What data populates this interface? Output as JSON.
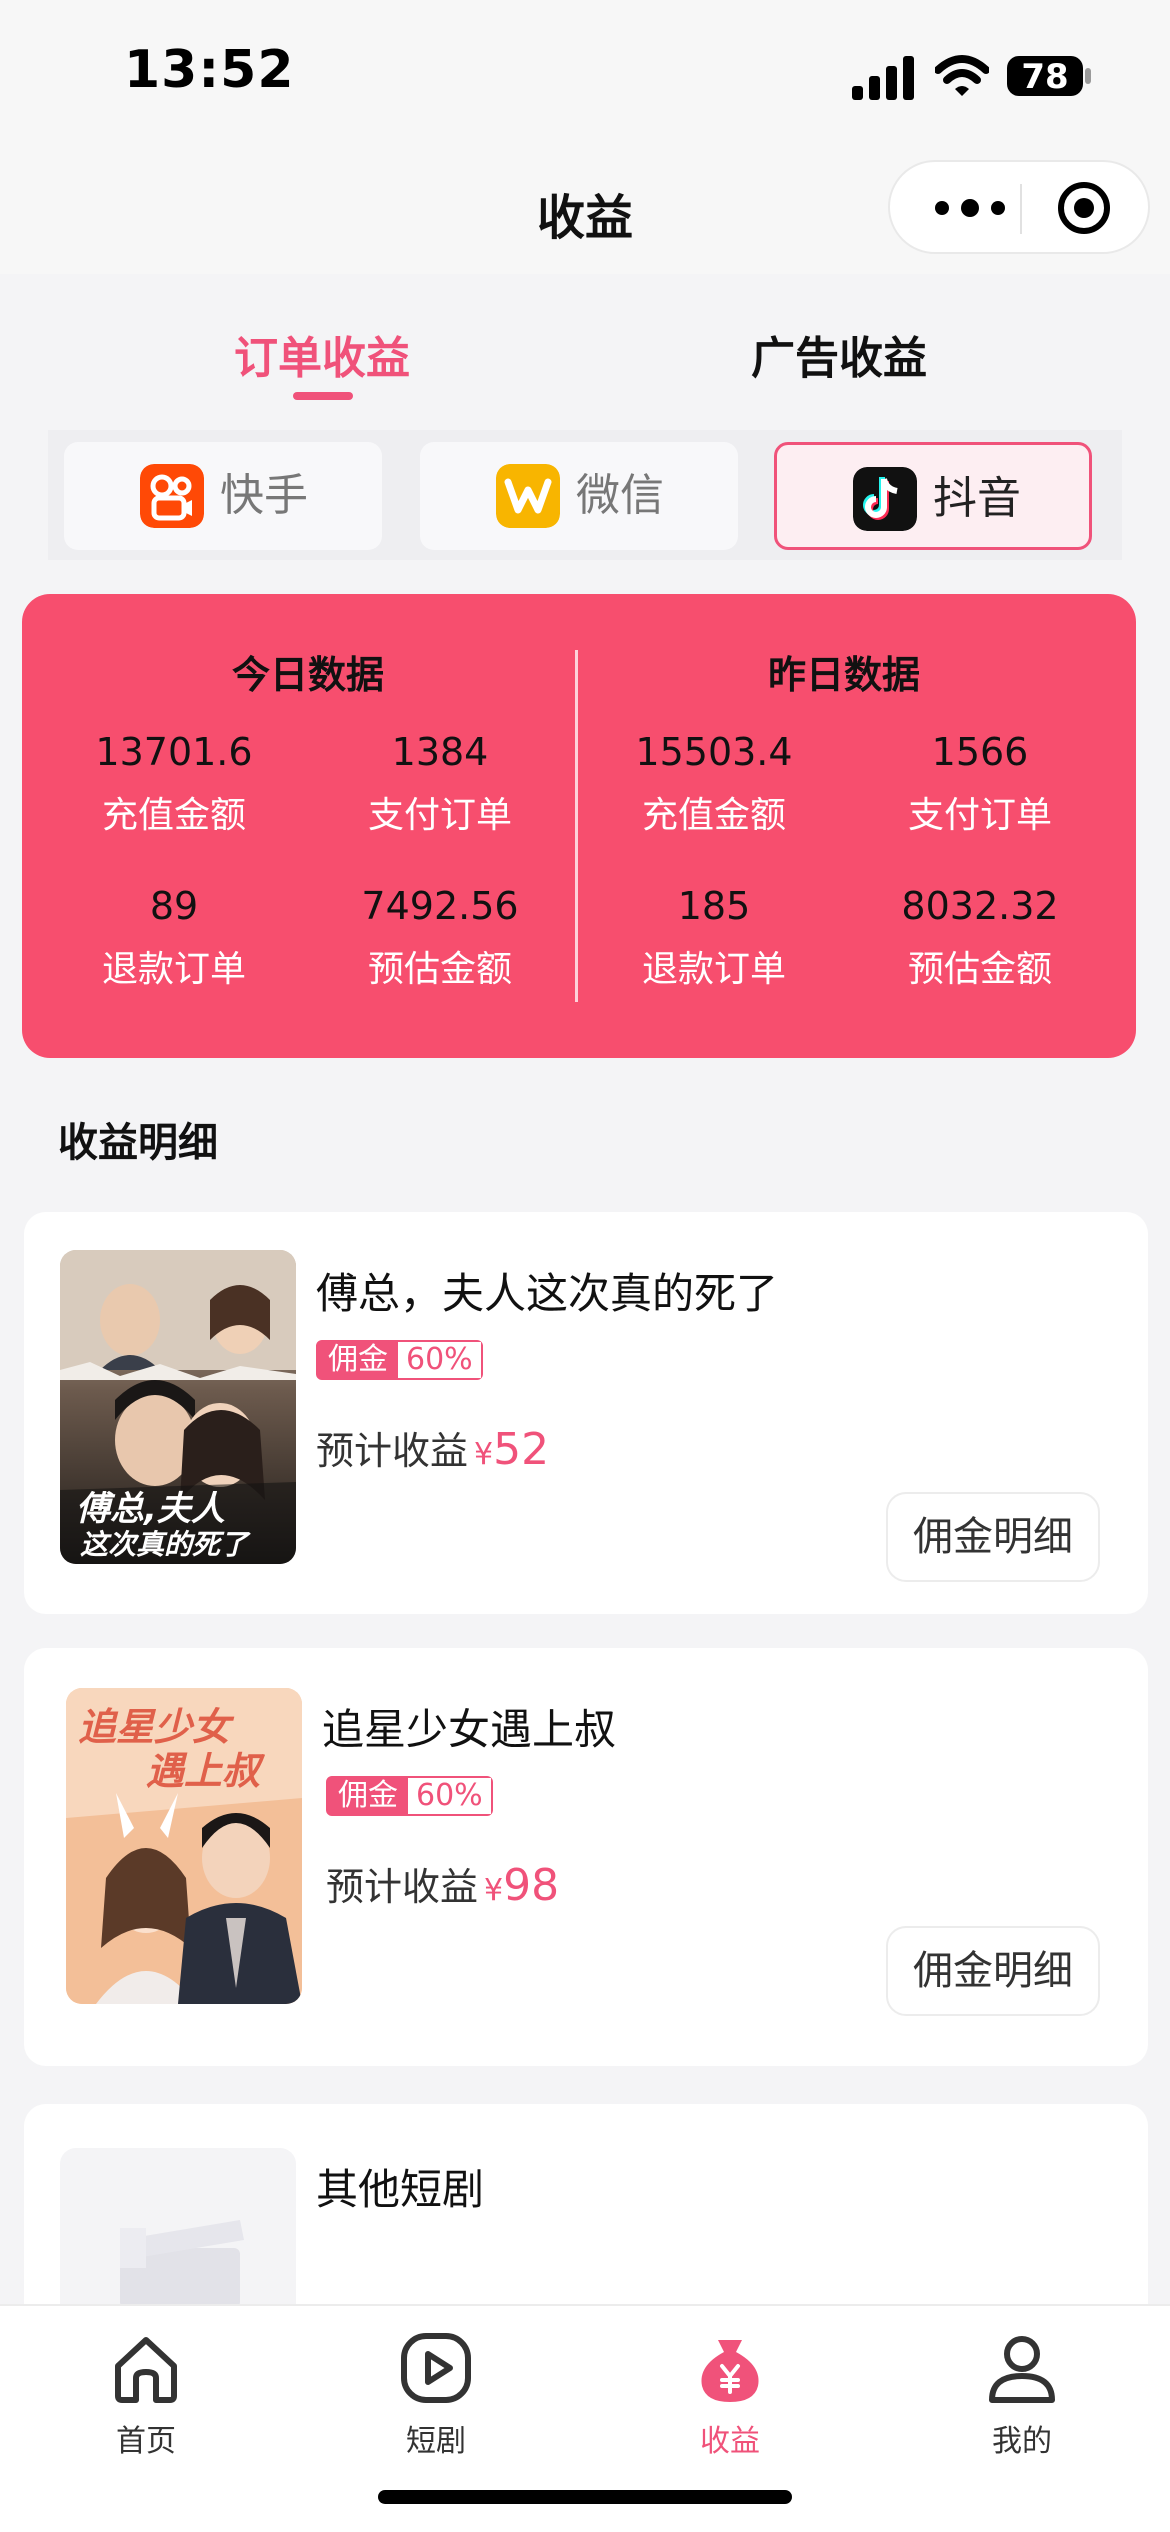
{
  "status_bar": {
    "time": "13:52",
    "battery": "78"
  },
  "nav": {
    "title": "收益"
  },
  "main_tabs": [
    {
      "label": "订单收益",
      "active": true
    },
    {
      "label": "广告收益",
      "active": false
    }
  ],
  "platforms": [
    {
      "label": "快手",
      "icon": "kuaishou-icon",
      "color": "#ff4906",
      "active": false
    },
    {
      "label": "微信",
      "icon": "wechat-icon",
      "color": "#f8b500",
      "active": false
    },
    {
      "label": "抖音",
      "icon": "douyin-icon",
      "color": "#111111",
      "active": true
    }
  ],
  "stats": {
    "today": {
      "title": "今日数据",
      "items": [
        {
          "value": "13701.6",
          "label": "充值金额"
        },
        {
          "value": "1384",
          "label": "支付订单"
        },
        {
          "value": "89",
          "label": "退款订单"
        },
        {
          "value": "7492.56",
          "label": "预估金额"
        }
      ]
    },
    "yesterday": {
      "title": "昨日数据",
      "items": [
        {
          "value": "15503.4",
          "label": "充值金额"
        },
        {
          "value": "1566",
          "label": "支付订单"
        },
        {
          "value": "185",
          "label": "退款订单"
        },
        {
          "value": "8032.32",
          "label": "预估金额"
        }
      ]
    }
  },
  "section": {
    "title": "收益明细"
  },
  "dramas": [
    {
      "title": "傅总，夫人这次真的死了",
      "poster_text_line1": "傅总,夫人",
      "poster_text_line2": "这次真的死了",
      "commission_label": "佣金",
      "commission_value": "60%",
      "estimate_label": "预计收益",
      "currency": "¥",
      "estimate_value": "52",
      "detail_button": "佣金明细"
    },
    {
      "title": "追星少女遇上叔",
      "poster_text_line1": "追星少女",
      "poster_text_line2": "遇上叔",
      "commission_label": "佣金",
      "commission_value": "60%",
      "estimate_label": "预计收益",
      "currency": "¥",
      "estimate_value": "98",
      "detail_button": "佣金明细"
    },
    {
      "title": "其他短剧"
    }
  ],
  "tab_bar": [
    {
      "label": "首页",
      "icon": "home-icon",
      "active": false
    },
    {
      "label": "短剧",
      "icon": "play-icon",
      "active": false
    },
    {
      "label": "收益",
      "icon": "money-bag-icon",
      "active": true
    },
    {
      "label": "我的",
      "icon": "user-icon",
      "active": false
    }
  ],
  "colors": {
    "accent": "#f0527a",
    "card": "#f74e6e"
  }
}
